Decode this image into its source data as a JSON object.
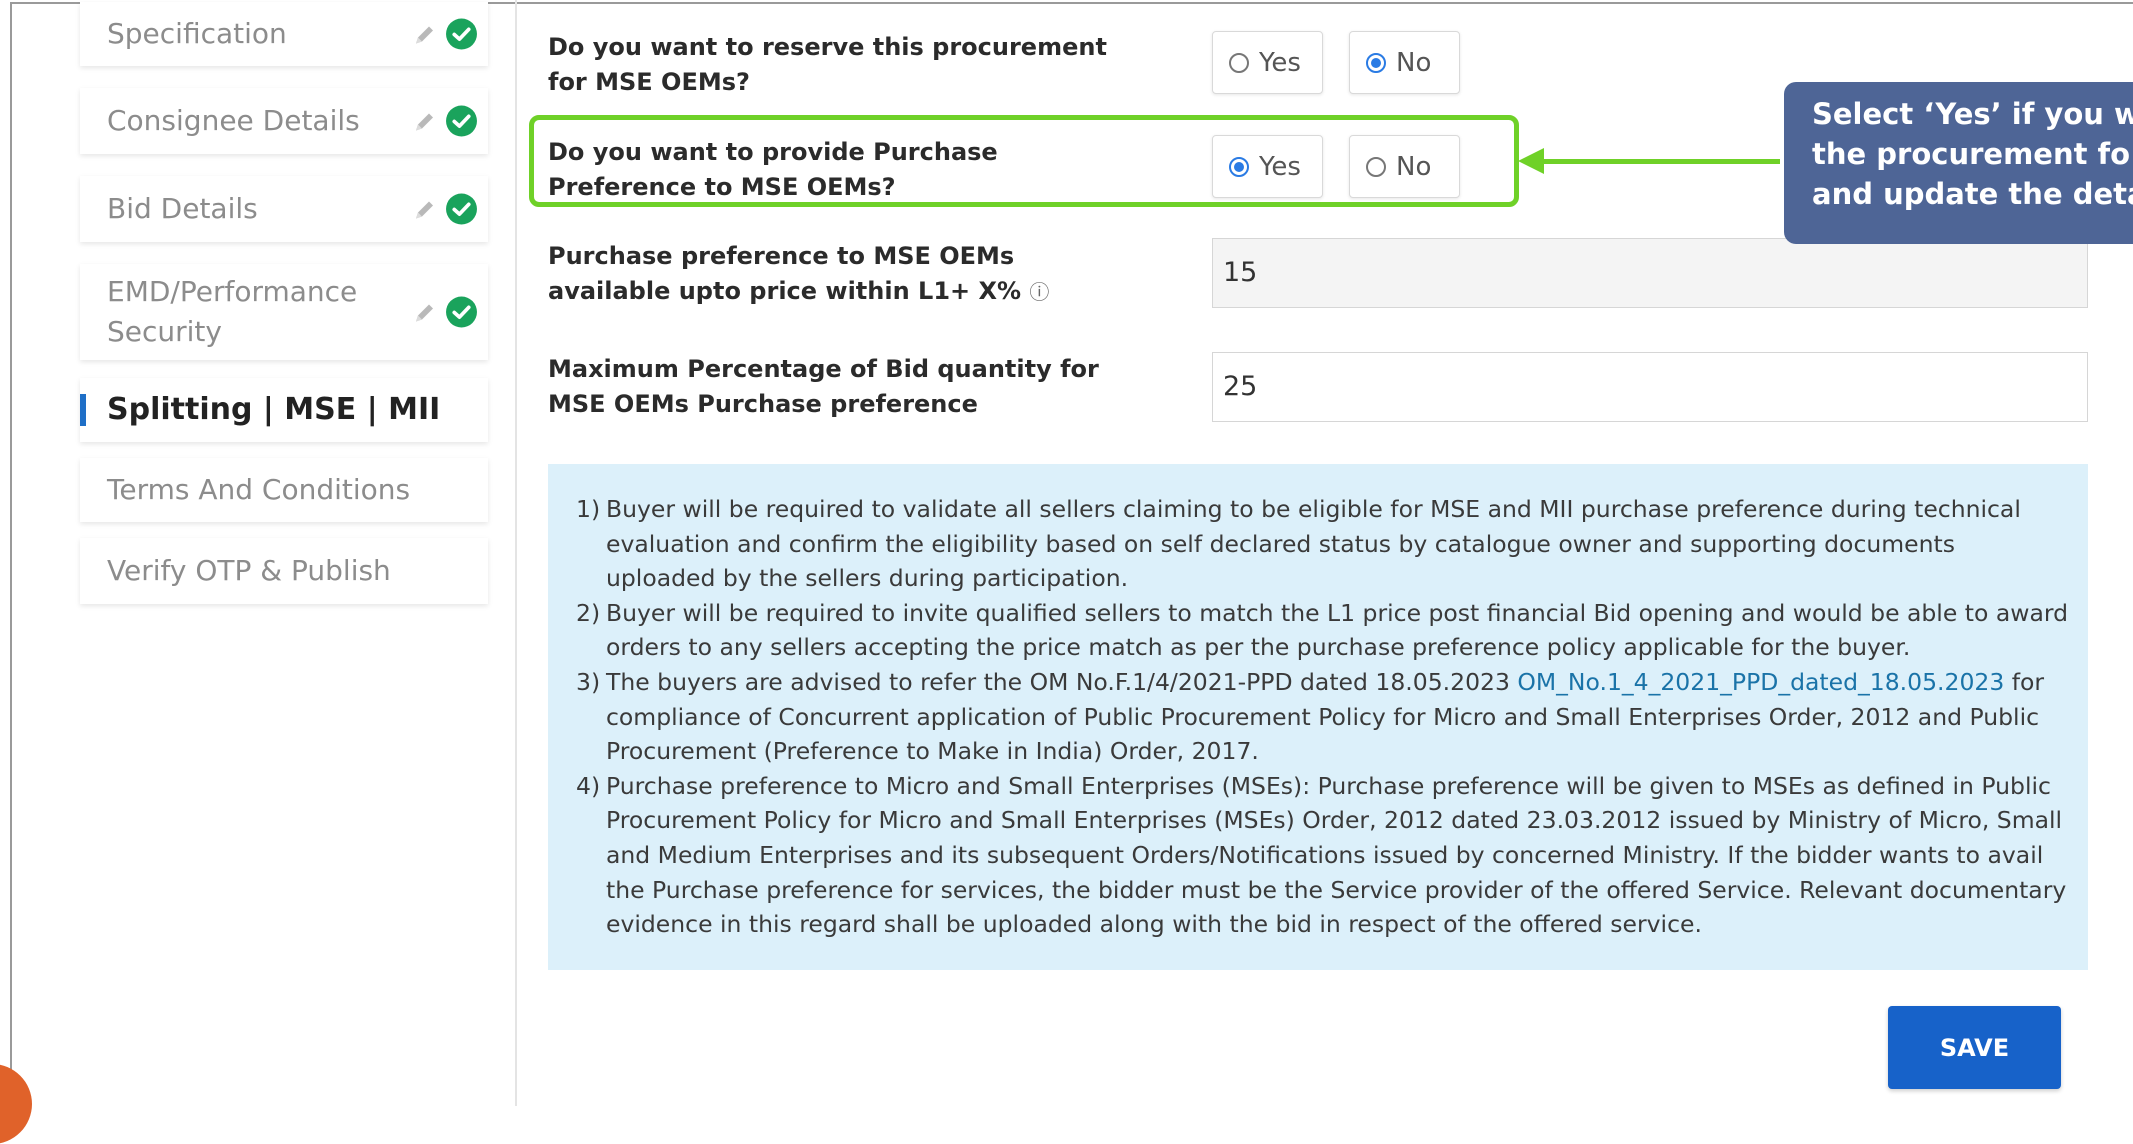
{
  "sidebar": {
    "items": [
      {
        "label": "Specification"
      },
      {
        "label": "Consignee Details"
      },
      {
        "label": "Bid Details"
      },
      {
        "label": "EMD/Performance Security"
      },
      {
        "label": "Splitting | MSE | MII"
      },
      {
        "label": "Terms And Conditions"
      },
      {
        "label": "Verify OTP & Publish"
      }
    ]
  },
  "form": {
    "q1": {
      "label": "Do you want to reserve this procurement for MSE OEMs?",
      "yes": "Yes",
      "no": "No",
      "selected": "No"
    },
    "q2": {
      "label": "Do you want to provide Purchase Preference to MSE OEMs?",
      "yes": "Yes",
      "no": "No",
      "selected": "Yes"
    },
    "q3": {
      "label": "Purchase preference to MSE OEMs available upto price within L1+ X%",
      "info_icon": "ⓘ",
      "value": "15"
    },
    "q4": {
      "label": "Maximum Percentage of Bid quantity for MSE OEMs Purchase preference",
      "value": "25"
    }
  },
  "callout": {
    "line1": "Select ‘Yes’ if you w",
    "line2": "the procurement fo",
    "line3": "and update the deta"
  },
  "notes": {
    "n1": {
      "num": "1)",
      "text": "Buyer will be required to validate all sellers claiming to be eligible for MSE and MII purchase preference during technical evaluation and confirm the eligibility based on self declared status by catalogue owner and supporting documents uploaded by the sellers during participation."
    },
    "n2": {
      "num": "2)",
      "text": "Buyer will be required to invite qualified sellers to match the L1 price post financial Bid opening and would be able to award orders to any sellers accepting the price match as per the purchase preference policy applicable for the buyer."
    },
    "n3": {
      "num": "3)",
      "text_a": "The buyers are advised to refer the OM No.F.1/4/2021-PPD dated 18.05.2023 ",
      "link": "OM_No.1_4_2021_PPD_dated_18.05.2023",
      "text_b": " for compliance of Concurrent application of Public Procurement Policy for Micro and Small Enterprises Order, 2012 and Public Procurement (Preference to Make in India) Order, 2017."
    },
    "n4": {
      "num": "4)",
      "text": "Purchase preference to Micro and Small Enterprises (MSEs): Purchase preference will be given to MSEs as defined in Public Procurement Policy for Micro and Small Enterprises (MSEs) Order, 2012 dated 23.03.2012 issued by Ministry of Micro, Small and Medium Enterprises and its subsequent Orders/Notifications issued by concerned Ministry. If the bidder wants to avail the Purchase preference for services, the bidder must be the Service provider of the offered Service. Relevant documentary evidence in this regard shall be uploaded along with the bid in respect of the offered service."
    }
  },
  "save_label": "SAVE",
  "colors": {
    "accent": "#1762c9",
    "highlight": "#6fd128",
    "callout": "#4e6596",
    "check": "#1aa35c",
    "notes_bg": "#dcf0fa"
  }
}
